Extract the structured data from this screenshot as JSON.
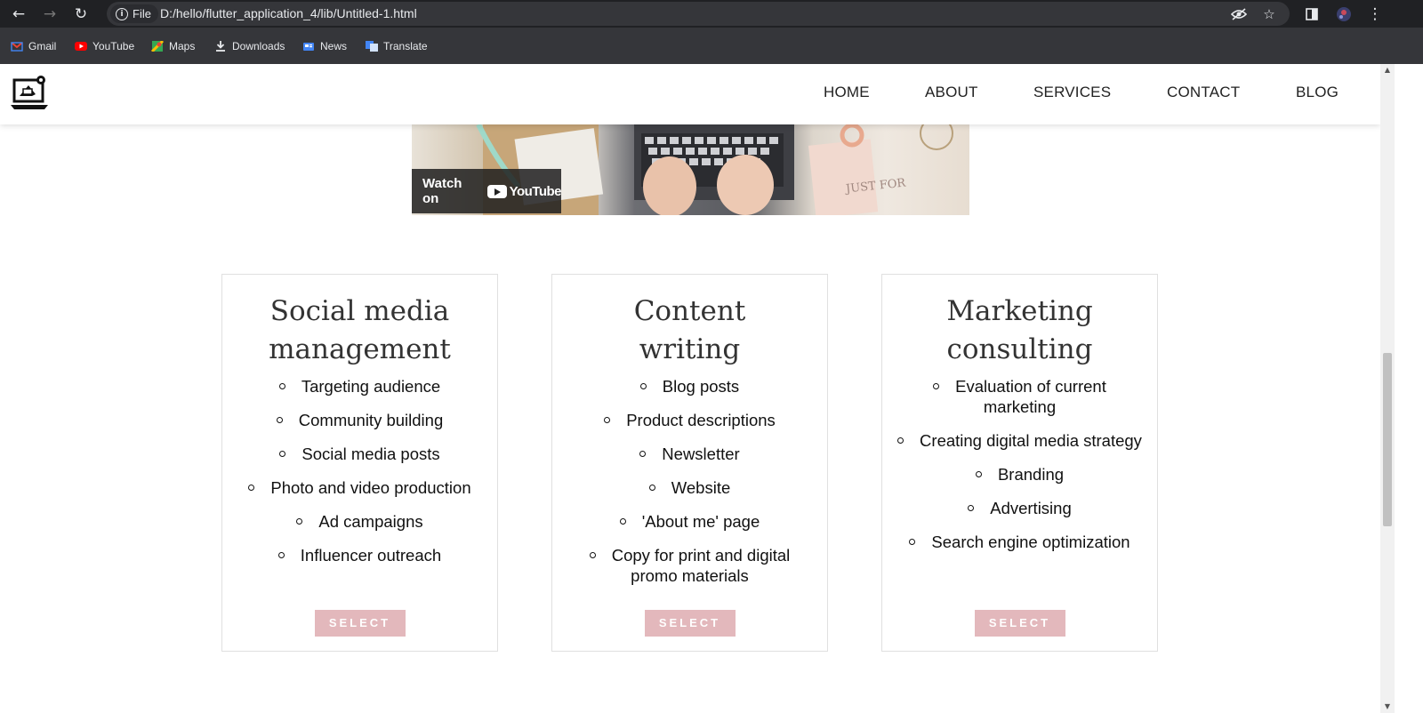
{
  "browser": {
    "url_chip": "File",
    "url": "D:/hello/flutter_application_4/lib/Untitled-1.html",
    "bookmarks": [
      {
        "label": "Gmail",
        "icon": "gmail-icon"
      },
      {
        "label": "YouTube",
        "icon": "youtube-icon"
      },
      {
        "label": "Maps",
        "icon": "maps-icon"
      },
      {
        "label": "Downloads",
        "icon": "download-icon"
      },
      {
        "label": "News",
        "icon": "news-icon"
      },
      {
        "label": "Translate",
        "icon": "translate-icon"
      }
    ]
  },
  "header": {
    "nav": [
      "HOME",
      "ABOUT",
      "SERVICES",
      "CONTACT",
      "BLOG"
    ]
  },
  "video": {
    "watch_on": "Watch on",
    "brand": "YouTube",
    "overlay_text": "JUST FOR"
  },
  "cards": [
    {
      "title_line1": "Social media",
      "title_line2": "management",
      "items": [
        "Targeting audience",
        "Community building",
        "Social media posts",
        "Photo and video production",
        "Ad campaigns",
        "Influencer outreach"
      ],
      "button": "SELECT"
    },
    {
      "title_line1": "Content",
      "title_line2": "writing",
      "items": [
        "Blog posts",
        "Product descriptions",
        "Newsletter",
        "Website",
        "'About me' page",
        "Copy for print and digital promo materials"
      ],
      "button": "SELECT"
    },
    {
      "title_line1": "Marketing",
      "title_line2": "consulting",
      "items": [
        "Evaluation of current marketing",
        "Creating digital media strategy",
        "Branding",
        "Advertising",
        "Search engine optimization"
      ],
      "button": "SELECT"
    }
  ],
  "colors": {
    "button": "#e3b8bc",
    "chrome_dark": "#202124",
    "bookmarks_bar": "#35363a"
  }
}
